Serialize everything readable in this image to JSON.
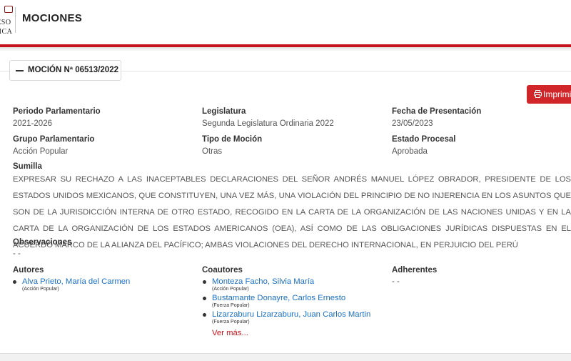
{
  "header": {
    "logo_word1": "RESO",
    "logo_word2": "LICA",
    "title": "MOCIONES"
  },
  "card": {
    "title": "MOCIÓN Nª 06513/2022",
    "print_label": "Imprimi"
  },
  "fields": {
    "periodo": {
      "label": "Periodo Parlamentario",
      "value": "2021-2026"
    },
    "legislatura": {
      "label": "Legislatura",
      "value": "Segunda Legislatura Ordinaria 2022"
    },
    "fecha": {
      "label": "Fecha de Presentación",
      "value": "23/05/2023"
    },
    "grupo": {
      "label": "Grupo Parlamentario",
      "value": "Acción Popular"
    },
    "tipo": {
      "label": "Tipo de Moción",
      "value": "Otras"
    },
    "estado": {
      "label": "Estado Procesal",
      "value": "Aprobada"
    },
    "sumilla": {
      "label": "Sumilla",
      "value": "EXPRESAR SU RECHAZO A LAS INACEPTABLES DECLARACIONES DEL SEÑOR ANDRÉS MANUEL LÓPEZ OBRADOR, PRESIDENTE DE LOS ESTADOS UNIDOS MEXICANOS, QUE CONSTITUYEN, UNA VEZ MÁS, UNA VIOLACIÓN DEL PRINCIPIO DE NO INJERENCIA EN LOS ASUNTOS QUE SON DE LA JURISDICCIÓN INTERNA DE OTRO ESTADO, RECOGIDO EN LA CARTA DE LA ORGANIZACIÓN DE LAS NACIONES UNIDAS Y EN LA CARTA DE LA ORGANIZACIÓN DE LOS ESTADOS AMERICANOS (OEA), ASÍ COMO DE LAS OBLIGACIONES JURÍDICAS DISPUESTAS EN EL ACUERDO MARCO DE LA ALIANZA DEL PACÍFICO; AMBAS VIOLACIONES DEL DERECHO INTERNACIONAL, EN PERJUICIO DEL PERÚ"
    },
    "observaciones": {
      "label": "Observaciones",
      "value": "- -"
    }
  },
  "autores": {
    "label": "Autores",
    "items": [
      {
        "name": "Alva Prieto, María del Carmen",
        "party": "(Acción Popular)"
      }
    ]
  },
  "coautores": {
    "label": "Coautores",
    "items": [
      {
        "name": "Monteza Facho, Silvia María",
        "party": "(Acción Popular)"
      },
      {
        "name": "Bustamante Donayre, Carlos Ernesto",
        "party": "(Fuerza Popular)"
      },
      {
        "name": "Lizarzaburu Lizarzaburu, Juan Carlos Martin",
        "party": "(Fuerza Popular)"
      }
    ],
    "more_label": "Ver más..."
  },
  "adherentes": {
    "label": "Adherentes",
    "value": "- -"
  },
  "colors": {
    "accent": "#c5121b",
    "link": "#1a6fc4",
    "button": "#d0262a"
  }
}
